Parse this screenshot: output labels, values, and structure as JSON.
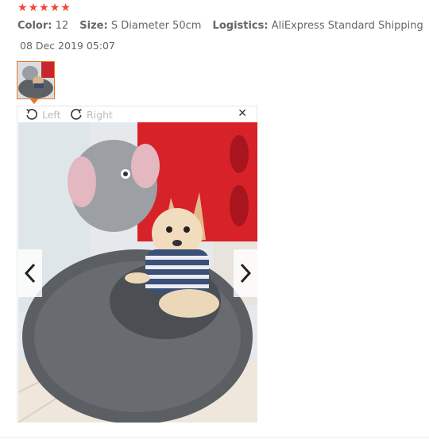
{
  "rating": {
    "stars": 5,
    "max": 5,
    "star_color": "#f44336"
  },
  "meta": {
    "color_label": "Color:",
    "color_value": "12",
    "size_label": "Size:",
    "size_value": "S Diameter 50cm",
    "logistics_label": "Logistics:",
    "logistics_value": "AliExpress Standard Shipping"
  },
  "review": {
    "date": "08 Dec 2019 05:07"
  },
  "viewer": {
    "rotate_left_label": "Left",
    "rotate_right_label": "Right"
  },
  "icons": {
    "rotate_left": "rotate-left-icon",
    "rotate_right": "rotate-right-icon",
    "close": "close-icon",
    "prev": "chevron-left-icon",
    "next": "chevron-right-icon"
  },
  "colors": {
    "accent": "#e87722",
    "text": "#666666",
    "muted": "#bbbbbb"
  }
}
